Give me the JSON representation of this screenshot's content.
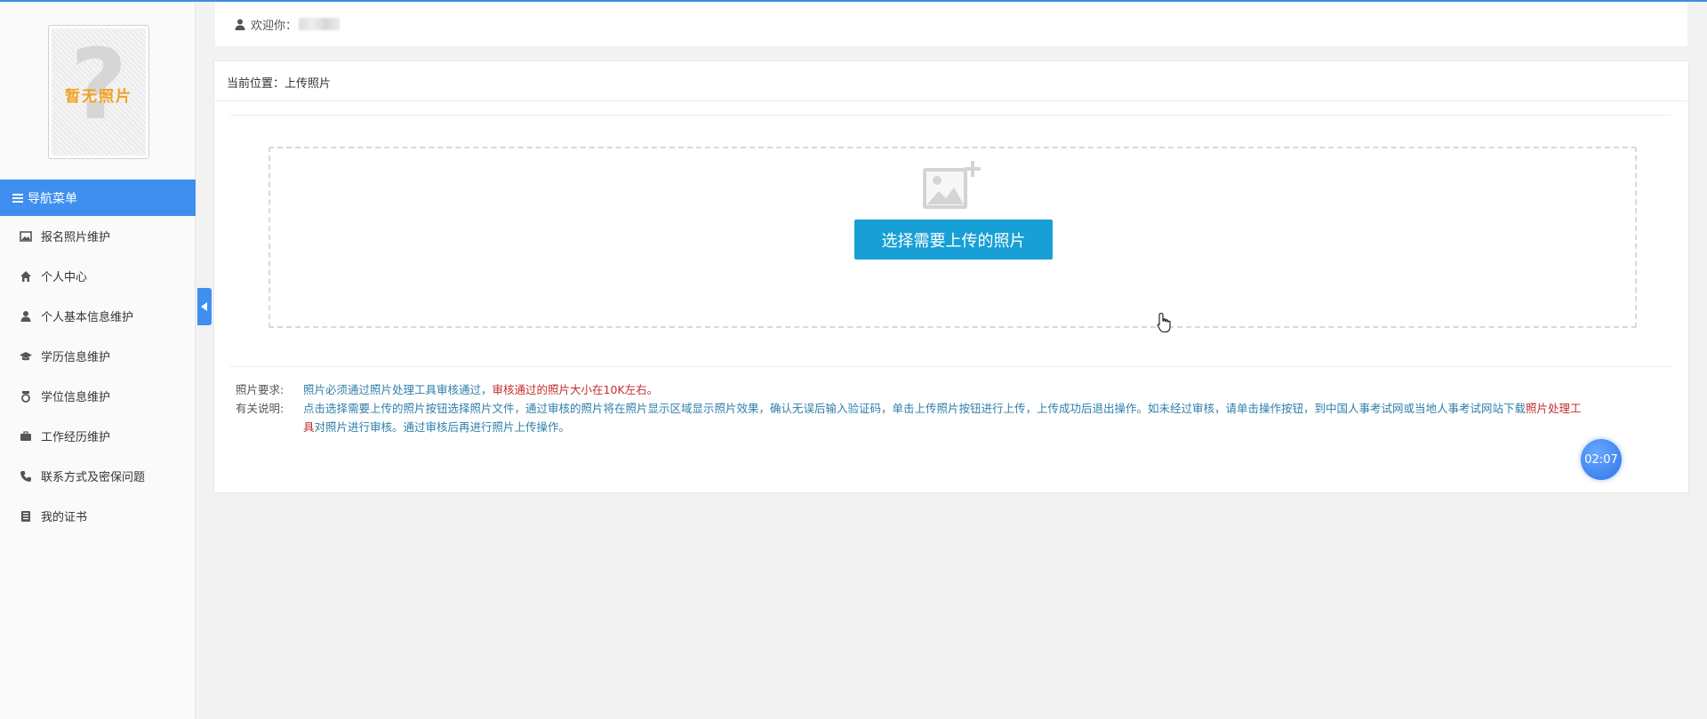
{
  "sidebar": {
    "photo_placeholder": "暂无照片",
    "photo_placeholder_glyph": "?",
    "nav_header": "导航菜单",
    "items": [
      {
        "label": "报名照片维护",
        "icon": "image-icon"
      },
      {
        "label": "个人中心",
        "icon": "home-icon"
      },
      {
        "label": "个人基本信息维护",
        "icon": "user-icon"
      },
      {
        "label": "学历信息维护",
        "icon": "graduation-cap-icon"
      },
      {
        "label": "学位信息维护",
        "icon": "medal-icon"
      },
      {
        "label": "工作经历维护",
        "icon": "briefcase-icon"
      },
      {
        "label": "联系方式及密保问题",
        "icon": "phone-icon"
      },
      {
        "label": "我的证书",
        "icon": "book-icon"
      }
    ]
  },
  "header": {
    "welcome": "欢迎你："
  },
  "main": {
    "breadcrumb": "当前位置：上传照片",
    "upload_button": "选择需要上传的照片",
    "requirements_label": "照片要求:",
    "requirements_text_1": "照片必须通过照片处理工具审核通过，",
    "requirements_text_2": "审核通过的照片大小在10K左右。",
    "instructions_label": "有关说明:",
    "instructions_text_1": "点击选择需要上传的照片按钮选择照片文件，通过审核的照片将在照片显示区域显示照片效果，确认无误后输入验证码，单击上传照片按钮进行上传，上传成功后退出操作。如未经过审核，请单击",
    "instructions_text_2": "操作按钮，到中国人事考试网或当地人事考试网站下载",
    "instructions_link": "照片处理工具",
    "instructions_text_3": "对照片进行审核。通过审核后再进行照片上传操作。"
  },
  "timer": "02:07",
  "colors": {
    "accent": "#3f8ff0",
    "button": "#18a0d6",
    "note_text": "#2f7fa8",
    "note_red": "#c42e2e",
    "placeholder_orange": "#f0a21e"
  }
}
